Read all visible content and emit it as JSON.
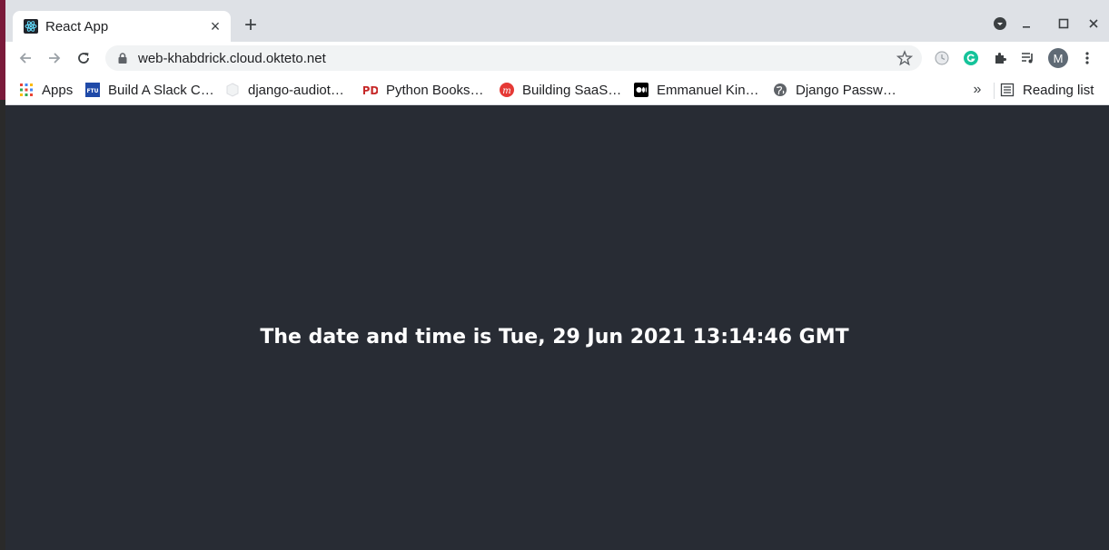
{
  "tab": {
    "title": "React App",
    "favicon": "react-logo-icon"
  },
  "toolbar": {
    "url": "web-khabdrick.cloud.okteto.net"
  },
  "bookmarks": [
    {
      "label": "Apps",
      "icon": "apps-grid-icon"
    },
    {
      "label": "Build A Slack C…",
      "icon": "ftu-icon"
    },
    {
      "label": "django-audiot…",
      "icon": "cube-icon"
    },
    {
      "label": "Python Books…",
      "icon": "pd-icon"
    },
    {
      "label": "Building SaaS…",
      "icon": "m-logo-icon"
    },
    {
      "label": "Emmanuel Kin…",
      "icon": "medium-icon"
    },
    {
      "label": "Django Passw…",
      "icon": "globe-icon"
    }
  ],
  "reading_list": "Reading list",
  "profile_initial": "M",
  "page": {
    "message": "The date and time is Tue, 29 Jun 2021 13:14:46 GMT"
  },
  "colors": {
    "page_background": "#282c34",
    "page_text": "#ffffff",
    "chrome_frame": "#dee1e6"
  }
}
